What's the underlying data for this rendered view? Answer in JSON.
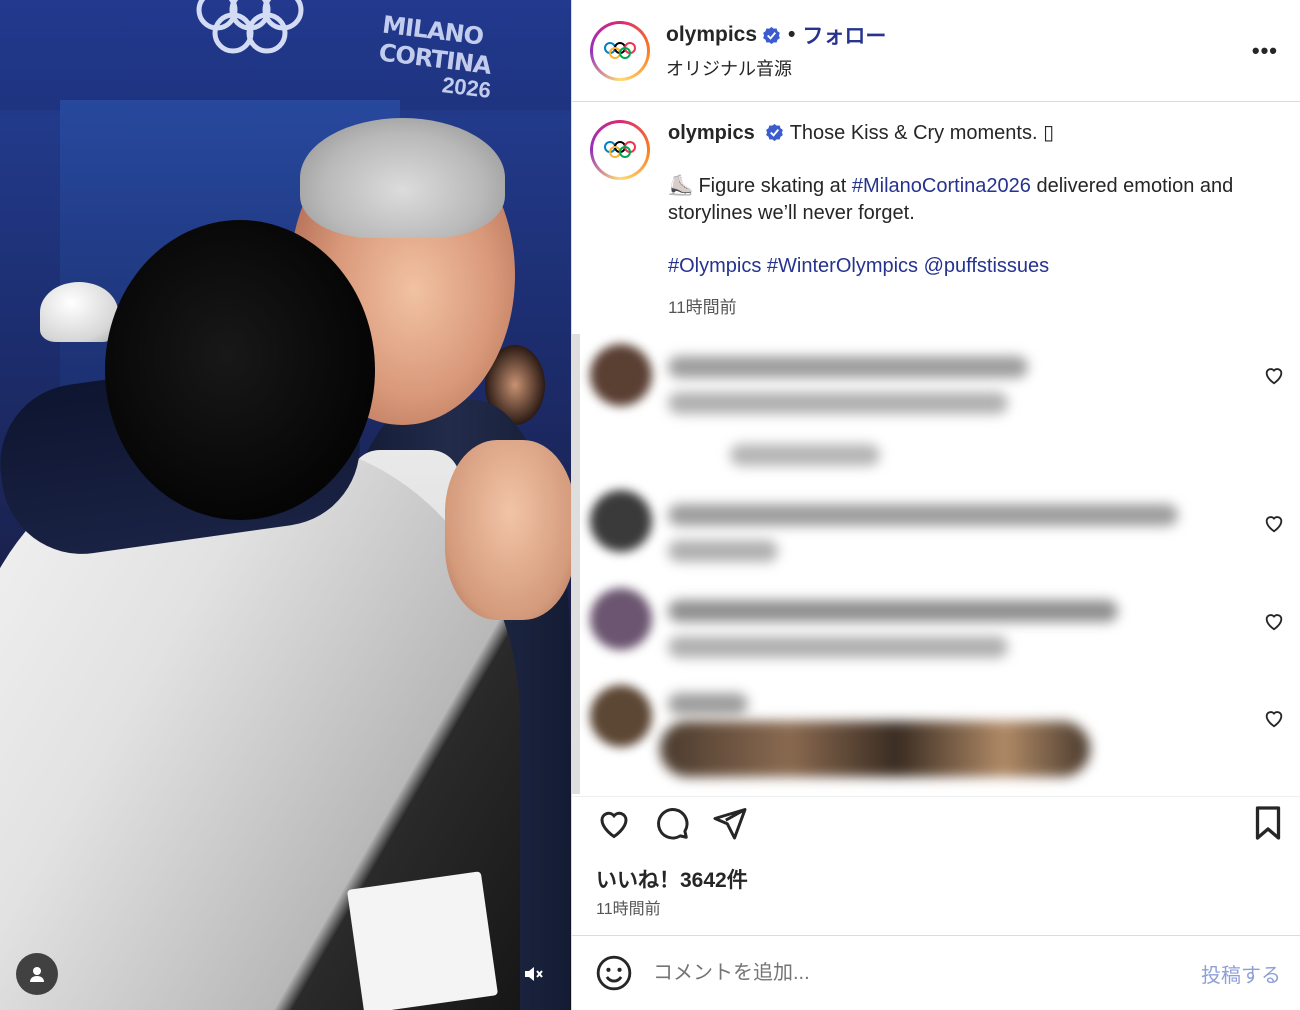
{
  "header": {
    "username": "olympics",
    "separator": "•",
    "follow_label": "フォロー",
    "audio_label": "オリジナル音源",
    "more_label": "•••"
  },
  "caption": {
    "username": "olympics",
    "headline": "Those Kiss & Cry moments. ▯",
    "line2_prefix": "⛸️ Figure skating at ",
    "line2_tag": "#MilanoCortina2026",
    "line2_suffix": " delivered emotion and storylines we’ll never forget.",
    "tag1": "#Olympics",
    "tag2": "#WinterOlympics",
    "mention": "@puffstissues",
    "time": "11時間前"
  },
  "media": {
    "banner_text": "MILANO CORTINA",
    "banner_year": "2026"
  },
  "actions": {
    "likes_text": "いいね！3642件",
    "time": "11時間前"
  },
  "comment_box": {
    "placeholder": "コメントを追加...",
    "post_label": "投稿する"
  },
  "colors": {
    "link": "#26338f",
    "verified": "#3b5ccf",
    "post_disabled": "#8fa0d8"
  }
}
